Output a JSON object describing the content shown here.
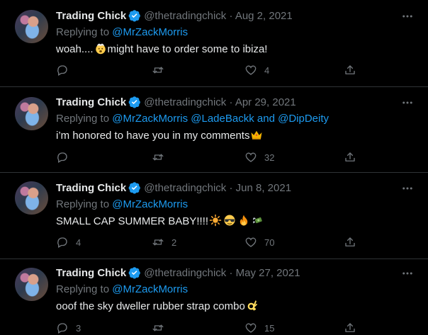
{
  "tweets": [
    {
      "name": "Trading Chick",
      "handle": "@thetradingchick",
      "dot": "·",
      "date": "Aug 2, 2021",
      "replying_label": "Replying to",
      "mention1": "@MrZackMorris",
      "mention_join": "",
      "mention2": "",
      "text_before": "woah....",
      "text_after": "might have to order some to ibiza!",
      "emojis": [
        "mind-blown-emoji"
      ],
      "reply_count": "",
      "retweet_count": "",
      "like_count": "4"
    },
    {
      "name": "Trading Chick",
      "handle": "@thetradingchick",
      "dot": "·",
      "date": "Apr 29, 2021",
      "replying_label": "Replying to",
      "mention1": "@MrZackMorris @LadeBackk",
      "mention_join": "and",
      "mention2": "@DipDeity",
      "text_before": "i’m honored to have you in my comments",
      "text_after": "",
      "emojis": [
        "crown-emoji"
      ],
      "reply_count": "",
      "retweet_count": "",
      "like_count": "32"
    },
    {
      "name": "Trading Chick",
      "handle": "@thetradingchick",
      "dot": "·",
      "date": "Jun 8, 2021",
      "replying_label": "Replying to",
      "mention1": "@MrZackMorris",
      "mention_join": "",
      "mention2": "",
      "text_before": "SMALL CAP SUMMER BABY!!!!",
      "text_after": "",
      "emojis": [
        "sun-emoji",
        "sunglasses-emoji",
        "fire-emoji",
        "money-with-wings-emoji"
      ],
      "reply_count": "4",
      "retweet_count": "2",
      "like_count": "70"
    },
    {
      "name": "Trading Chick",
      "handle": "@thetradingchick",
      "dot": "·",
      "date": "May 27, 2021",
      "replying_label": "Replying to",
      "mention1": "@MrZackMorris",
      "mention_join": "",
      "mention2": "",
      "text_before": "ooof the sky dweller rubber strap combo",
      "text_after": "",
      "emojis": [
        "ok-hand-emoji"
      ],
      "reply_count": "3",
      "retweet_count": "",
      "like_count": "15"
    }
  ],
  "colors": {
    "background": "#000000",
    "text": "#e7e9ea",
    "muted": "#71767b",
    "link": "#1d9bf0",
    "divider": "#2f3336",
    "verified": "#1d9bf0"
  }
}
